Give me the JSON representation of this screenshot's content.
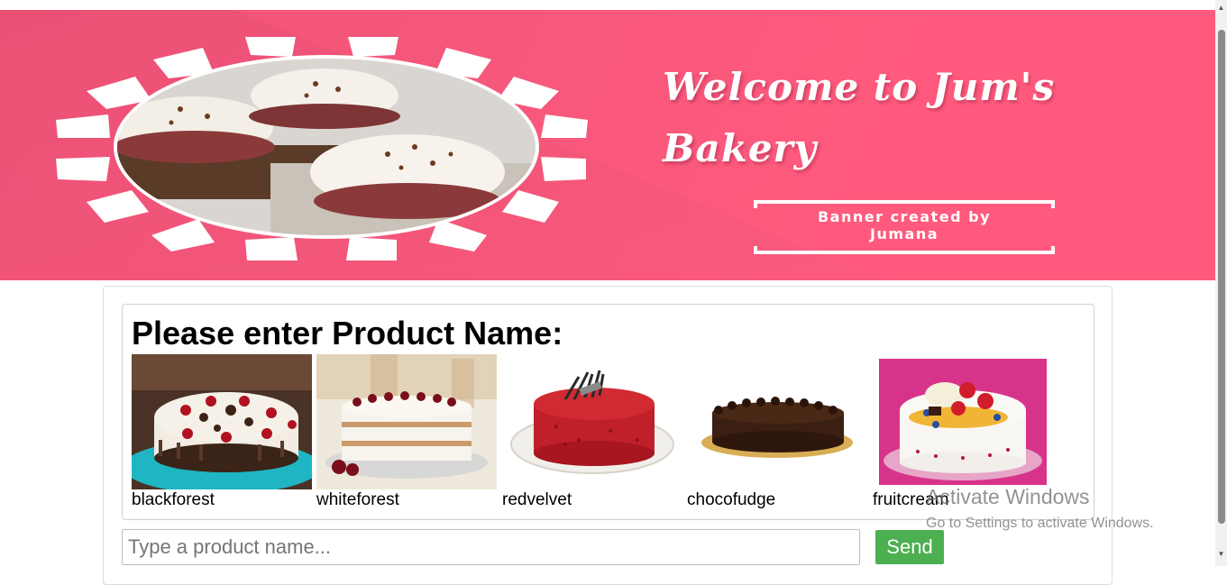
{
  "banner": {
    "title_line1": "Welcome to Jum's",
    "title_line2": "Bakery",
    "credit_line1": "Banner created by",
    "credit_line2": "Jumana",
    "accent_color": "#ff5a7d"
  },
  "main": {
    "heading": "Please enter Product Name:",
    "products": [
      {
        "label": "blackforest",
        "icon": "blackforest-cake-image"
      },
      {
        "label": "whiteforest",
        "icon": "whiteforest-cake-image"
      },
      {
        "label": "redvelvet",
        "icon": "redvelvet-cake-image"
      },
      {
        "label": "chocofudge",
        "icon": "chocofudge-cake-image"
      },
      {
        "label": "fruitcream",
        "icon": "fruitcream-cake-image"
      }
    ]
  },
  "search": {
    "placeholder": "Type a product name...",
    "value": "",
    "send_label": "Send",
    "send_color": "#4caf50"
  },
  "watermark": {
    "title": "Activate Windows",
    "subtitle": "Go to Settings to activate Windows."
  }
}
